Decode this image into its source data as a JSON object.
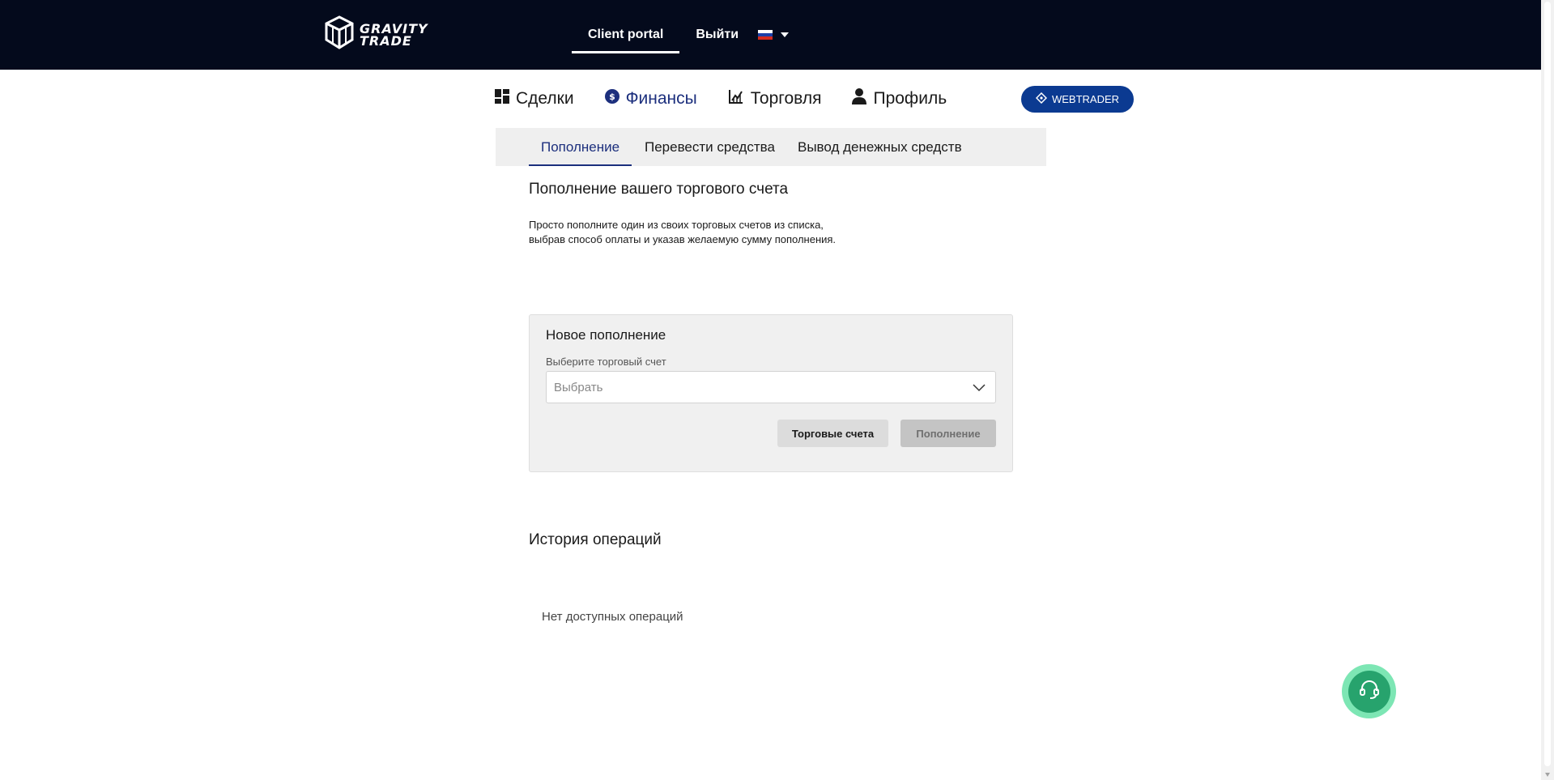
{
  "header": {
    "logo_text": "GRAVITY TRADE",
    "logo_line1": "GRAVITY",
    "logo_line2": "TRADE",
    "nav": [
      {
        "label": "Client portal",
        "active": true
      },
      {
        "label": "Выйти",
        "active": false
      }
    ],
    "language": {
      "selected": "ru",
      "icon": "flag-ru-icon"
    },
    "bg_color": "#040a1c"
  },
  "main_nav": {
    "items": [
      {
        "label": "Сделки",
        "icon": "dashboard-icon",
        "active": false
      },
      {
        "label": "Финансы",
        "icon": "dollar-circle-icon",
        "active": true
      },
      {
        "label": "Торговля",
        "icon": "chart-icon",
        "active": false
      },
      {
        "label": "Профиль",
        "icon": "user-icon",
        "active": false
      }
    ],
    "webtrader_label": "WEBTRADER",
    "accent_color": "#0b3a91"
  },
  "tabs": [
    {
      "label": "Пополнение",
      "active": true
    },
    {
      "label": "Перевести средства",
      "active": false
    },
    {
      "label": "Вывод денежных средств",
      "active": false
    }
  ],
  "deposit": {
    "title": "Пополнение вашего торгового счета",
    "description": "Просто пополните один из своих торговых счетов из списка, выбрав способ оплаты и указав желаемую сумму пополнения."
  },
  "form": {
    "title": "Новое пополнение",
    "account_label": "Выберите торговый счет",
    "account_placeholder": "Выбрать",
    "accounts_button": "Торговые счета",
    "deposit_button": "Пополнение"
  },
  "history": {
    "title": "История операций",
    "empty_text": "Нет доступных операций"
  },
  "support": {
    "icon": "headset-icon",
    "color": "#27a36d"
  }
}
